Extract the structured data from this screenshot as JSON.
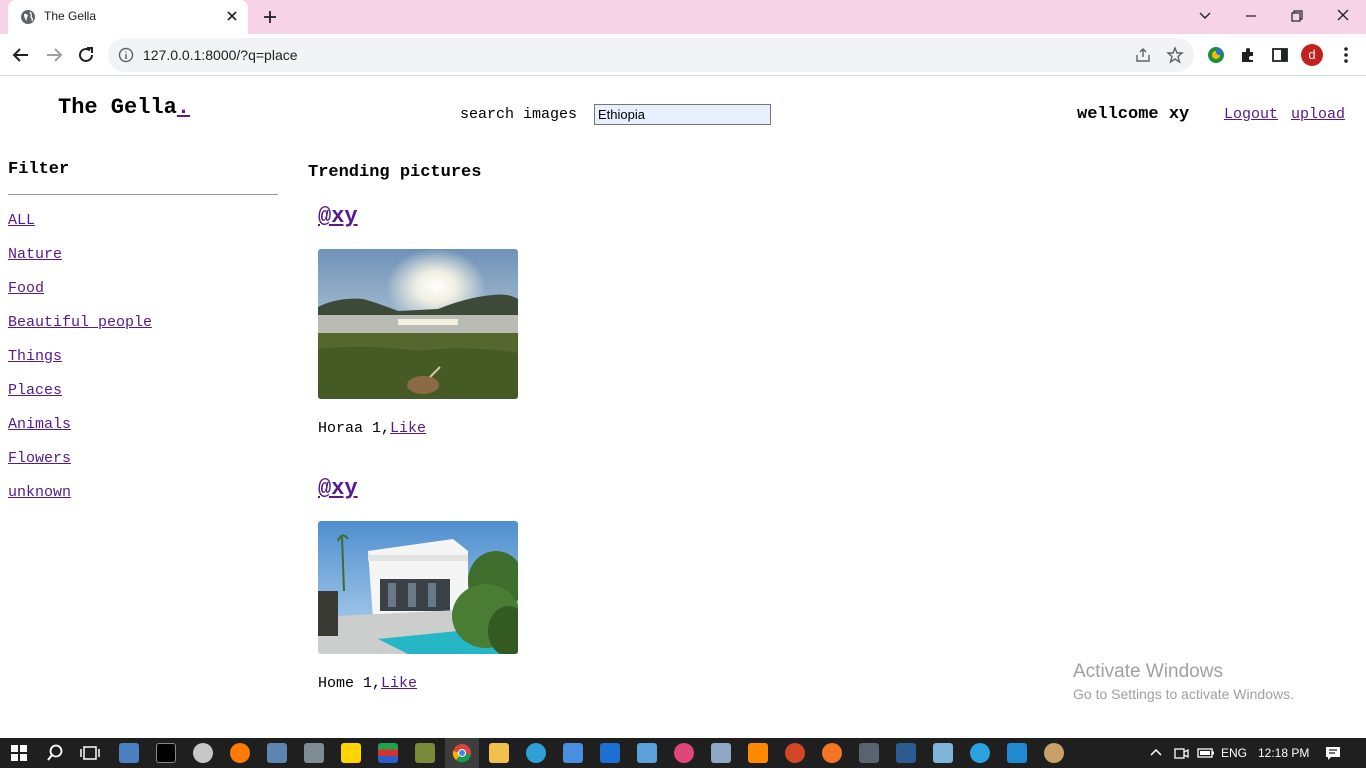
{
  "browser": {
    "tab_title": "The Gella",
    "url": "127.0.0.1:8000/?q=place",
    "avatar_letter": "d"
  },
  "header": {
    "brand": "The Gella",
    "brand_dot": ".",
    "search_label": "search images",
    "search_value": "Ethiopia",
    "welcome": "wellcome xy",
    "logout": "Logout",
    "upload": "upload"
  },
  "sidebar": {
    "title": "Filter",
    "items": [
      {
        "label": "ALL"
      },
      {
        "label": "Nature"
      },
      {
        "label": "Food"
      },
      {
        "label": "Beautiful people"
      },
      {
        "label": "Things"
      },
      {
        "label": "Places"
      },
      {
        "label": "Animals"
      },
      {
        "label": "Flowers"
      },
      {
        "label": "unknown"
      }
    ]
  },
  "main": {
    "title": "Trending pictures",
    "posts": [
      {
        "user": "@xy",
        "caption": "Horaa 1,",
        "like": "Like"
      },
      {
        "user": "@xy",
        "caption": "Home 1,",
        "like": "Like"
      }
    ]
  },
  "watermark": {
    "line1": "Activate Windows",
    "line2": "Go to Settings to activate Windows."
  },
  "taskbar": {
    "language": "ENG",
    "time": "12:18 PM"
  }
}
